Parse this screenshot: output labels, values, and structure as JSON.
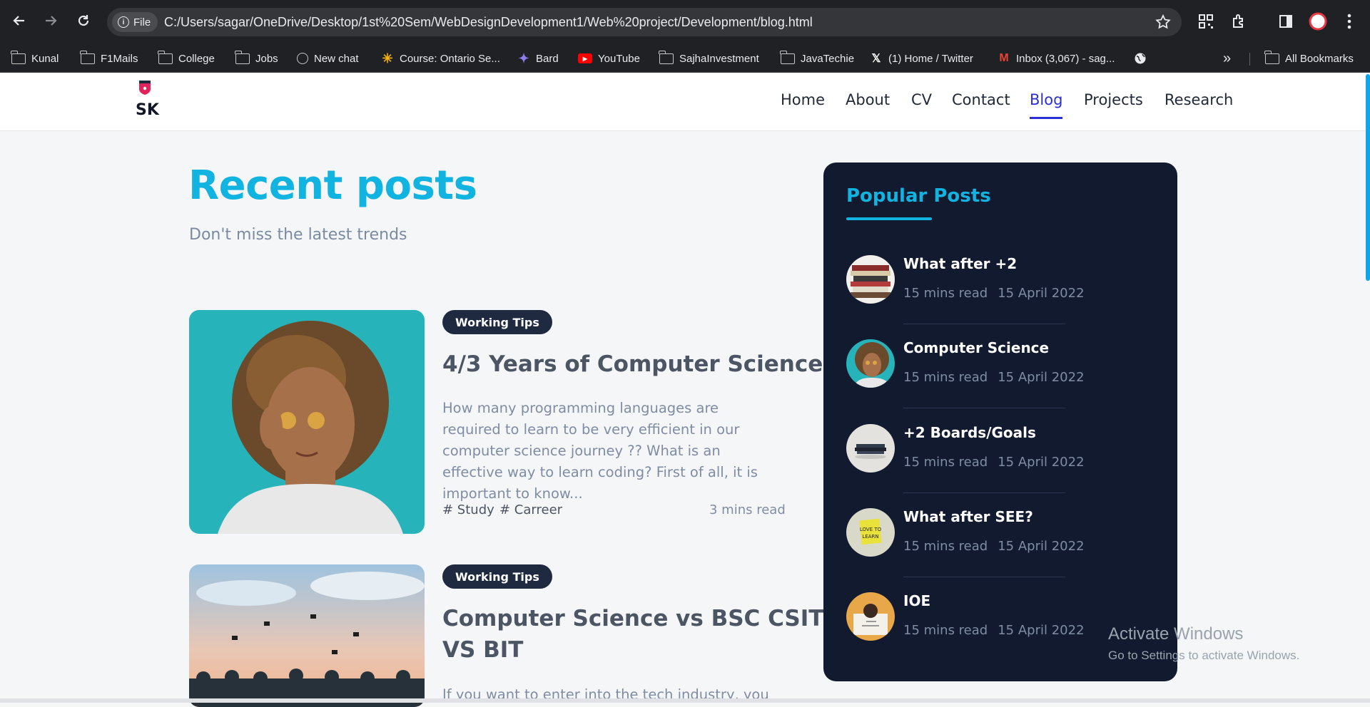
{
  "browser": {
    "site_chip": "File",
    "url": "C:/Users/sagar/OneDrive/Desktop/1st%20Sem/WebDesignDevelopment1/Web%20project/Development/blog.html",
    "bookmarks": [
      {
        "label": "Kunal",
        "icon": "folder-icon"
      },
      {
        "label": "F1Mails",
        "icon": "folder-icon"
      },
      {
        "label": "College",
        "icon": "folder-icon"
      },
      {
        "label": "Jobs",
        "icon": "folder-icon"
      },
      {
        "label": "New chat",
        "icon": "chatgpt-icon"
      },
      {
        "label": "Course: Ontario Se...",
        "icon": "course-icon"
      },
      {
        "label": "Bard",
        "icon": "bard-icon"
      },
      {
        "label": "YouTube",
        "icon": "youtube-icon"
      },
      {
        "label": "SajhaInvestment",
        "icon": "folder-icon"
      },
      {
        "label": "JavaTechie",
        "icon": "folder-icon"
      },
      {
        "label": "(1) Home / Twitter",
        "icon": "x-icon"
      },
      {
        "label": "Inbox (3,067) - sag...",
        "icon": "gmail-icon"
      },
      {
        "label": "",
        "icon": "globe-icon"
      }
    ],
    "overflow_label": "»",
    "all_bookmarks": "All Bookmarks"
  },
  "site": {
    "logo": "SK",
    "nav": [
      "Home",
      "About",
      "CV",
      "Contact",
      "Blog",
      "Projects",
      "Research"
    ],
    "active_nav": "Blog",
    "accent": "#11b3e0",
    "active_color": "#2b2fd6"
  },
  "main": {
    "heading": "Recent posts",
    "subheading": "Don't miss the latest trends",
    "posts": [
      {
        "badge": "Working Tips",
        "title": "4/3 Years of Computer Science",
        "excerpt": "How many programming languages are required to learn to be very efficient in our computer science journey ?? What is an effective way to learn coding? First of all, it is important to know...",
        "tags": [
          "# Study",
          "# Carreer"
        ],
        "read_time": "3 mins read"
      },
      {
        "badge": "Working Tips",
        "title_line1": "Computer Science vs BSC CSIT",
        "title_line2": "VS BIT",
        "excerpt": "If you want to enter into the tech industry, you"
      }
    ]
  },
  "sidebar": {
    "title": "Popular Posts",
    "items": [
      {
        "title": "What after +2",
        "read": "15 mins read",
        "date": "15 April 2022"
      },
      {
        "title": "Computer Science",
        "read": "15 mins read",
        "date": "15 April 2022"
      },
      {
        "title": "+2 Boards/Goals",
        "read": "15 mins read",
        "date": "15 April 2022"
      },
      {
        "title": "What after SEE?",
        "read": "15 mins read",
        "date": "15 April 2022"
      },
      {
        "title": "IOE",
        "read": "15 mins read",
        "date": "15 April 2022"
      }
    ]
  },
  "watermark": {
    "title": "Activate Windows",
    "subtitle": "Go to Settings to activate Windows."
  }
}
